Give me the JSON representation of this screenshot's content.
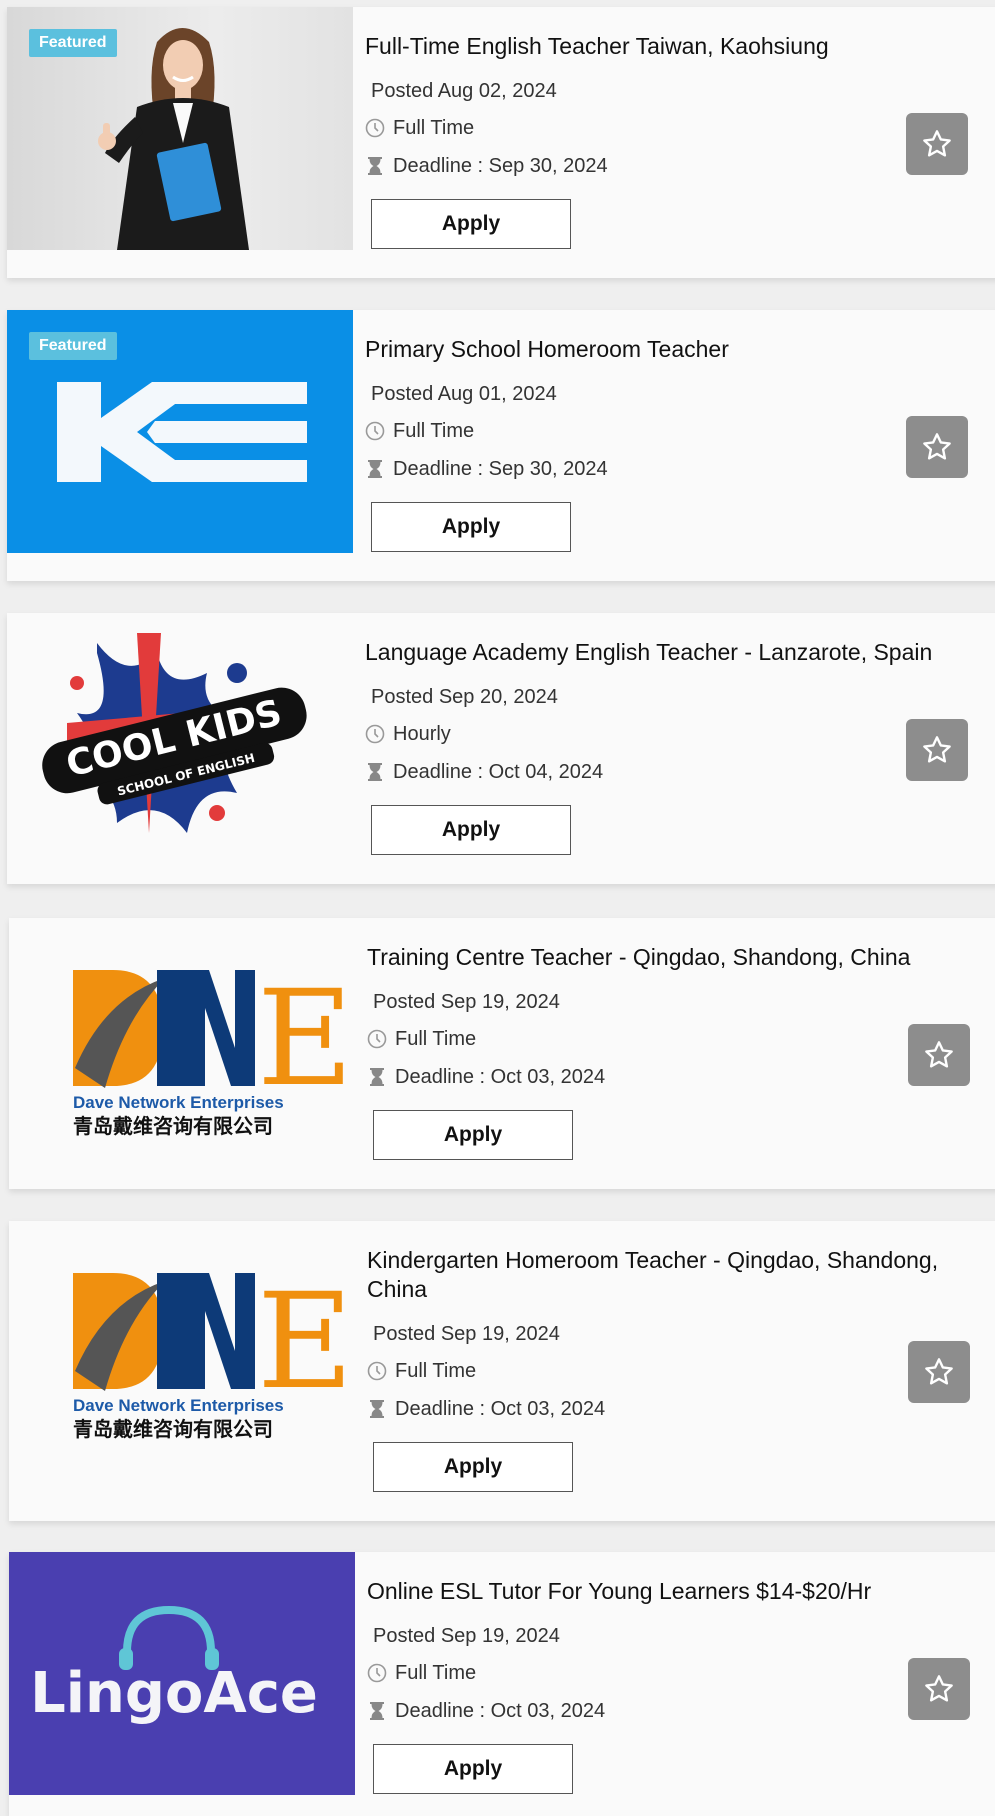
{
  "jobs": [
    {
      "title": "Full-Time English Teacher Taiwan, Kaohsiung",
      "posted": "Posted Aug 02, 2024",
      "type": "Full Time",
      "deadline": "Deadline : Sep 30, 2024",
      "apply_label": "Apply",
      "badge": "Featured"
    },
    {
      "title": "Primary School Homeroom Teacher",
      "posted": "Posted Aug 01, 2024",
      "type": "Full Time",
      "deadline": "Deadline : Sep 30, 2024",
      "apply_label": "Apply",
      "badge": "Featured"
    },
    {
      "title": "Language Academy English Teacher - Lanzarote, Spain",
      "posted": "Posted Sep 20, 2024",
      "type": "Hourly",
      "deadline": "Deadline : Oct 04, 2024",
      "apply_label": "Apply",
      "logo_line1": "COOL KIDS",
      "logo_line2": "SCHOOL OF ENGLISH"
    },
    {
      "title": "Training Centre Teacher - Qingdao, Shandong, China",
      "posted": "Posted Sep 19, 2024",
      "type": "Full Time",
      "deadline": "Deadline : Oct 03, 2024",
      "apply_label": "Apply",
      "logo_line1": "Dave Network Enterprises",
      "logo_line2": "青岛戴维咨询有限公司"
    },
    {
      "title": "Kindergarten Homeroom Teacher - Qingdao, Shandong, China",
      "posted": "Posted Sep 19, 2024",
      "type": "Full Time",
      "deadline": "Deadline : Oct 03, 2024",
      "apply_label": "Apply",
      "logo_line1": "Dave Network Enterprises",
      "logo_line2": "青岛戴维咨询有限公司"
    },
    {
      "title": "Online ESL Tutor For Young Learners $14-$20/Hr",
      "posted": "Posted Sep 19, 2024",
      "type": "Full Time",
      "deadline": "Deadline : Oct 03, 2024",
      "apply_label": "Apply",
      "logo_line1": "LingoAce"
    }
  ],
  "colors": {
    "badge": "#5bc0de",
    "favorite_button": "#8d8d8d",
    "ke_blue": "#0a8fe6",
    "dne_orange": "#f0900f",
    "dne_navy": "#0d3a78",
    "lingoace_purple": "#4a3fb0",
    "lingoace_teal": "#5fc6d6"
  },
  "icons": {
    "clock": "clock-icon",
    "hourglass": "hourglass-icon",
    "favorite": "star-icon"
  }
}
